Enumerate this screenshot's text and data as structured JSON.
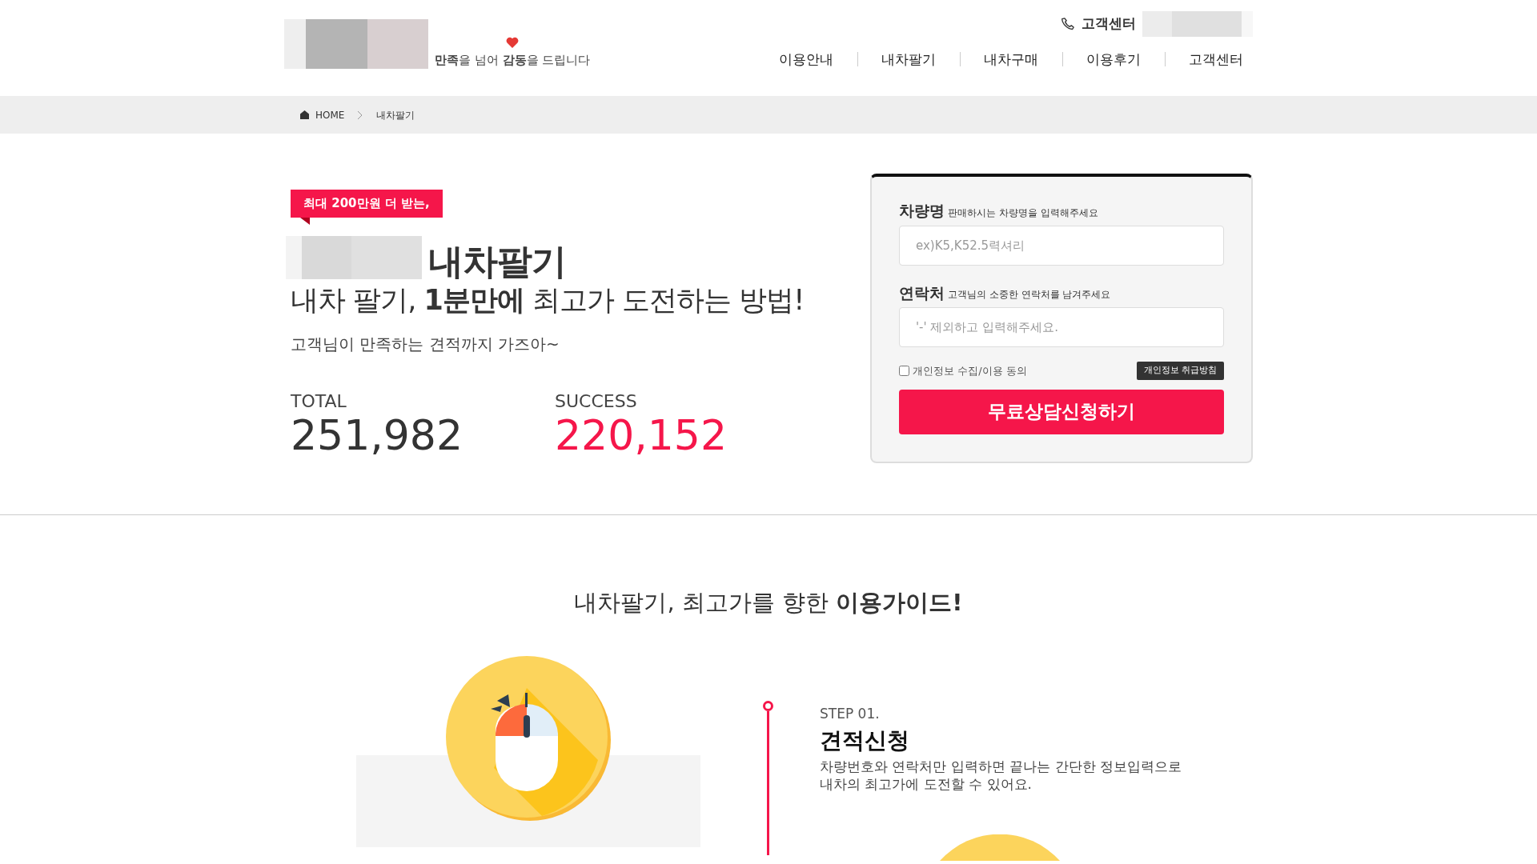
{
  "header": {
    "tagline": "**만족**을 넘어 **감동**을 드립니다",
    "support_label": "고객센터",
    "nav": [
      {
        "label": "이용안내"
      },
      {
        "label": "내차팔기"
      },
      {
        "label": "내차구매"
      },
      {
        "label": "이용후기"
      },
      {
        "label": "고객센터"
      }
    ]
  },
  "breadcrumb": [
    "HOME",
    "내차팔기"
  ],
  "hero": {
    "badge": "최대 200만원 더 받는,",
    "title": "내차팔기",
    "subtitle": "내차 팔기, **1분만에** 최고가 도전하는 방법!",
    "description": "고객님이 만족하는 견적까지 가즈아~",
    "stats": [
      {
        "label": "TOTAL",
        "value": "251,982",
        "color": "#333333"
      },
      {
        "label": "SUCCESS",
        "value": "220,152",
        "color": "#f5164a"
      }
    ]
  },
  "form": {
    "fields": [
      {
        "label": "차량명",
        "hint": "판매하시는 차량명을 입력해주세요",
        "placeholder": "ex)K5,K52.5력셔리"
      },
      {
        "label": "연락처",
        "hint": "고객님의 소중한 연락처를 남겨주세요",
        "placeholder": "'-' 제외하고 입력해주세요."
      }
    ],
    "consent": {
      "label": "개인정보 수집/이용 동의",
      "checked": false
    },
    "policy_button": "개인정보 취급방침",
    "submit": "무료상담신청하기"
  },
  "guide": {
    "title": "내차팔기, 최고가를 향한 **이용가이드!**",
    "steps": [
      {
        "step": "STEP 01.",
        "title": "견적신청",
        "description": "차량번호와 연락처만 입력하면 끝나는 간단한 정보입력으로 내차의 최고가에 도전할 수 있어요."
      }
    ]
  }
}
